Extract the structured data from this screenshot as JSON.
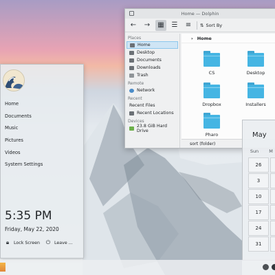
{
  "dolphin": {
    "title": "Home — Dolphin",
    "toolbar": {
      "sort_label": "Sort By"
    },
    "places": {
      "places_header": "Places",
      "places_items": [
        {
          "label": "Home",
          "icon": "home-icon"
        },
        {
          "label": "Desktop",
          "icon": "desktop-icon"
        },
        {
          "label": "Documents",
          "icon": "documents-icon"
        },
        {
          "label": "Downloads",
          "icon": "downloads-icon"
        },
        {
          "label": "Trash",
          "icon": "trash-icon"
        }
      ],
      "remote_header": "Remote",
      "remote_items": [
        {
          "label": "Network",
          "icon": "network-icon"
        }
      ],
      "recent_header": "Recent",
      "recent_items": [
        {
          "label": "Recent Files",
          "icon": "recent-files-icon"
        },
        {
          "label": "Recent Locations",
          "icon": "recent-locations-icon"
        }
      ],
      "devices_header": "Devices",
      "devices_items": [
        {
          "label": "23.8 GiB Hard Drive",
          "icon": "hard-drive-icon"
        }
      ]
    },
    "breadcrumb": "Home",
    "folders": [
      "CS",
      "Desktop",
      "Dropbox",
      "Installers",
      "Pharo"
    ],
    "status": "sort (folder)"
  },
  "launcher": {
    "menu": [
      "Home",
      "Documents",
      "Music",
      "Pictures",
      "Videos",
      "System Settings"
    ],
    "time": "5:35 PM",
    "date": "Friday, May 22, 2020",
    "lock_label": "Lock Screen",
    "leave_label": "Leave ..."
  },
  "calendar": {
    "month": "May",
    "weekdays": [
      "Sun",
      "M"
    ],
    "days": [
      "26",
      "3",
      "10",
      "17",
      "24",
      "31"
    ]
  },
  "colors": {
    "accent": "#3daee9",
    "folder": "#45b5e3"
  }
}
